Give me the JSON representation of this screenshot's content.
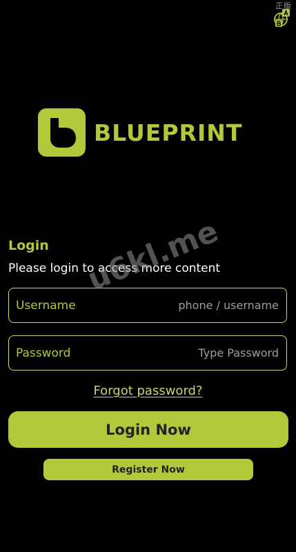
{
  "corner": {
    "text": "正版",
    "icon": "translate-icon"
  },
  "brand": {
    "name": "BLUEPRINT",
    "logo_icon": "blueprint-logo-icon",
    "accent_color": "#b0c93a"
  },
  "login": {
    "heading": "Login",
    "subtitle": "Please login to access more content"
  },
  "form": {
    "username": {
      "label": "Username",
      "value": "",
      "placeholder": "phone / username"
    },
    "password": {
      "label": "Password",
      "value": "",
      "placeholder": "Type Password"
    }
  },
  "links": {
    "forgot_password": "Forgot password?"
  },
  "buttons": {
    "login": "Login Now",
    "register": "Register Now"
  },
  "watermark": "u6kl.me"
}
